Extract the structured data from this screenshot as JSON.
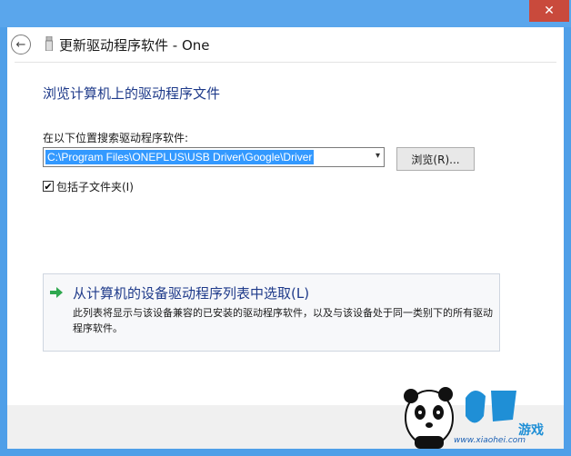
{
  "window": {
    "title": "更新驱动程序软件 - One",
    "close_glyph": "✕",
    "back_glyph": "←"
  },
  "page": {
    "heading": "浏览计算机上的驱动程序文件",
    "search_label": "在以下位置搜索驱动程序软件:",
    "path_value": "C:\\Program Files\\ONEPLUS\\USB Driver\\Google\\Driver",
    "combo_arrow": "▾",
    "browse_button": "浏览(R)...",
    "include_subfolders_label": "包括子文件夹(I)",
    "include_subfolders_checked": "✔"
  },
  "pick_option": {
    "title": "从计算机的设备驱动程序列表中选取(L)",
    "description": "此列表将显示与该设备兼容的已安装的驱动程序软件，以及与该设备处于同一类别下的所有驱动程序软件。"
  },
  "watermark": {
    "text": "www.xiaohei.com"
  },
  "colors": {
    "accent": "#1e3a8a",
    "chrome": "#5aa6ec",
    "selection": "#3399ff",
    "close": "#c94a3c"
  },
  "icons": [
    "back-icon",
    "device-icon",
    "close-icon",
    "chevron-down-icon",
    "green-arrow-icon",
    "panda-logo"
  ]
}
